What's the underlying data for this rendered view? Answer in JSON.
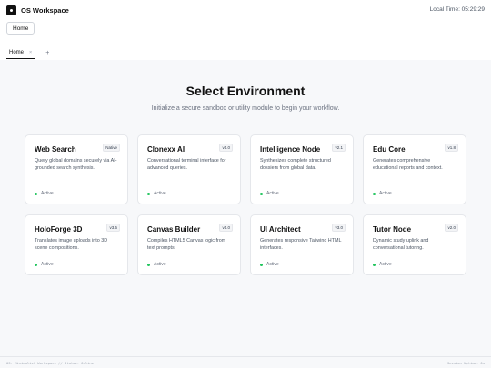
{
  "header": {
    "brand": "OS Workspace",
    "local_time": "Local Time: 05:29:29",
    "home_button": "Home"
  },
  "tabs": [
    {
      "label": "Home",
      "close": "×"
    }
  ],
  "tab_add": "+",
  "main": {
    "title": "Select Environment",
    "subtitle": "Initialize a secure sandbox or utility module to begin your workflow."
  },
  "cards": [
    {
      "name": "Web Search",
      "badge": "Native",
      "desc": "Query global domains securely via AI-grounded search synthesis.",
      "status": "Active"
    },
    {
      "name": "Clonexx AI",
      "badge": "v4.0",
      "desc": "Conversational terminal interface for advanced queries.",
      "status": "Active"
    },
    {
      "name": "Intelligence Node",
      "badge": "v2.1",
      "desc": "Synthesizes complete structured dossiers from global data.",
      "status": "Active"
    },
    {
      "name": "Edu Core",
      "badge": "v1.8",
      "desc": "Generates comprehensive educational reports and context.",
      "status": "Active"
    },
    {
      "name": "HoloForge 3D",
      "badge": "v3.5",
      "desc": "Translates image uploads into 3D scene compositions.",
      "status": "Active"
    },
    {
      "name": "Canvas Builder",
      "badge": "v4.0",
      "desc": "Compiles HTML5 Canvas logic from text prompts.",
      "status": "Active"
    },
    {
      "name": "UI Architect",
      "badge": "v3.0",
      "desc": "Generates responsive Tailwind HTML interfaces.",
      "status": "Active"
    },
    {
      "name": "Tutor Node",
      "badge": "v2.0",
      "desc": "Dynamic study uplink and conversational tutoring.",
      "status": "Active"
    }
  ],
  "footer": {
    "left": "OS: Minimalist Workspace // Status: Online",
    "right": "Session Uptime: 0s"
  },
  "colors": {
    "background": "#f7f8fa",
    "accent": "#111111",
    "active_dot": "#22c55e"
  }
}
